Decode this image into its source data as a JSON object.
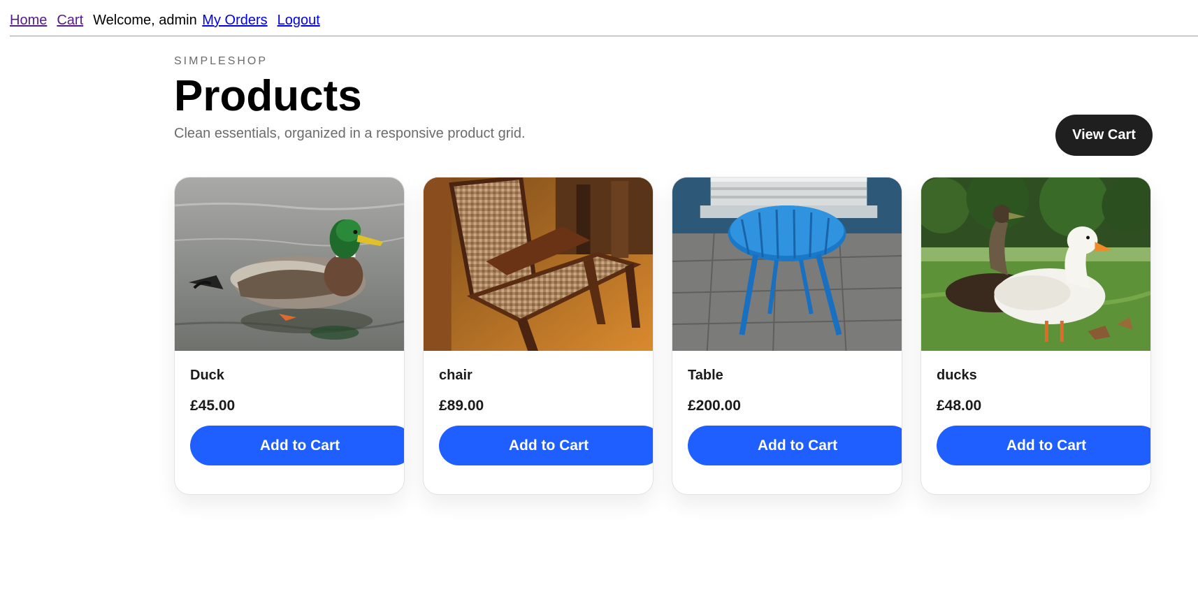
{
  "nav": {
    "home": "Home",
    "cart": "Cart",
    "welcome": "Welcome, admin",
    "orders": "My Orders",
    "logout": "Logout"
  },
  "header": {
    "eyebrow": "SIMPLESHOP",
    "title": "Products",
    "subtitle": "Clean essentials, organized in a responsive product grid.",
    "view_cart": "View Cart"
  },
  "colors": {
    "accent": "#1f5eff",
    "dark_button": "#1f1f1f"
  },
  "products": [
    {
      "name": "Duck",
      "price": "£45.00",
      "button": "Add to Cart",
      "image": "mallard-duck-photo"
    },
    {
      "name": "chair",
      "price": "£89.00",
      "button": "Add to Cart",
      "image": "wooden-chair-photo"
    },
    {
      "name": "Table",
      "price": "£200.00",
      "button": "Add to Cart",
      "image": "blue-table-photo"
    },
    {
      "name": "ducks",
      "price": "£48.00",
      "button": "Add to Cart",
      "image": "white-ducks-photo"
    }
  ]
}
